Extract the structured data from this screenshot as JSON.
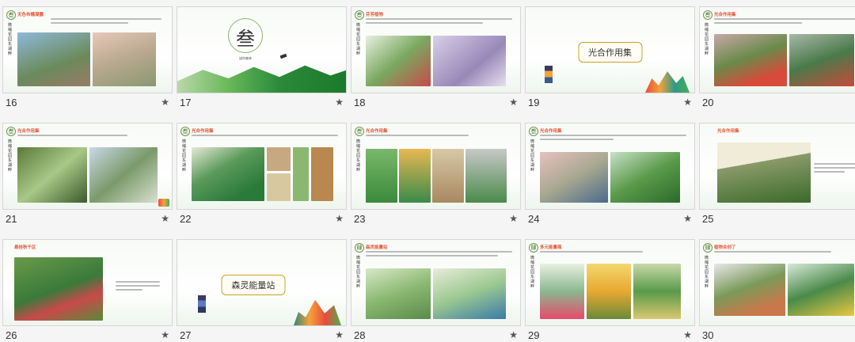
{
  "slides": [
    {
      "num": "16",
      "heading": "无色布幡凝露"
    },
    {
      "num": "17",
      "cover_char": "叁",
      "cover_sub": "迷你森林"
    },
    {
      "num": "18",
      "heading": "芬芳植物"
    },
    {
      "num": "19",
      "title": "光合作用集"
    },
    {
      "num": "20",
      "heading": "光合作用集"
    },
    {
      "num": "21",
      "heading": "光合作用集"
    },
    {
      "num": "22",
      "heading": "光合作用集"
    },
    {
      "num": "23",
      "heading": "光合作用集"
    },
    {
      "num": "24",
      "heading": "光合作用集"
    },
    {
      "num": "25",
      "heading": "光合作用集"
    },
    {
      "num": "26",
      "heading": "悬挂秋千区"
    },
    {
      "num": "27",
      "title": "森灵能量站"
    },
    {
      "num": "28",
      "heading": "森灵能量站"
    },
    {
      "num": "29",
      "heading": "多元能量瓶"
    },
    {
      "num": "30",
      "heading": "植物合创了"
    }
  ],
  "badge_char": "叁",
  "badge_char2": "肆",
  "vertical_title": "微缩花园东湖畔",
  "star_glyph": "★",
  "colors": {
    "accent": "#e25a3a",
    "green": "#4caf50"
  }
}
